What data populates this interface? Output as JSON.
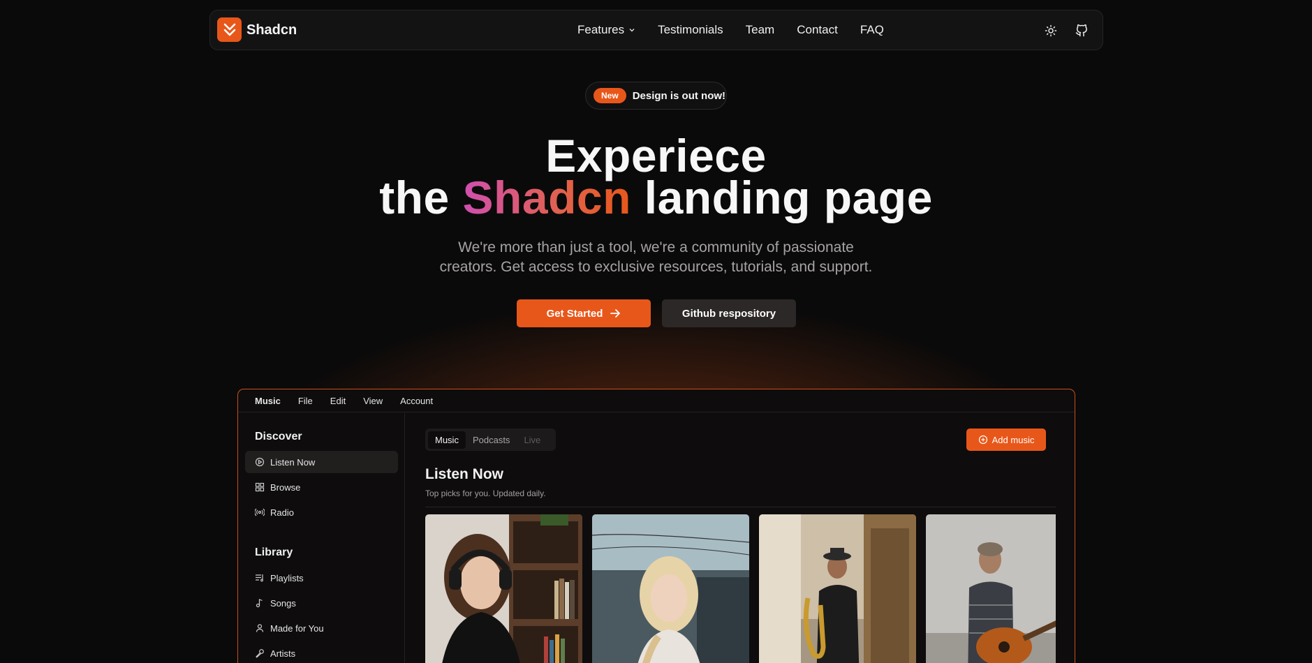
{
  "navbar": {
    "brand": "Shadcn",
    "links": [
      {
        "label": "Features",
        "has_dropdown": true
      },
      {
        "label": "Testimonials"
      },
      {
        "label": "Team"
      },
      {
        "label": "Contact"
      },
      {
        "label": "FAQ"
      }
    ],
    "icons": [
      "sun-icon",
      "github-icon"
    ]
  },
  "hero": {
    "badge_pill": "New",
    "badge_text": "Design is out now!",
    "title_line1": "Experiece",
    "title_line2_pre": "the",
    "title_line2_brand": "Shadcn",
    "title_line2_post": "landing page",
    "subtitle_line1": "We're more than just a tool, we're a community of passionate",
    "subtitle_line2": "creators. Get access to exclusive resources, tutorials, and support.",
    "primary_cta": "Get Started",
    "secondary_cta": "Github respository"
  },
  "app": {
    "menubar": [
      "Music",
      "File",
      "Edit",
      "View",
      "Account"
    ],
    "sidebar": {
      "discover_heading": "Discover",
      "discover_items": [
        {
          "label": "Listen Now",
          "icon": "play-circle-icon",
          "active": true
        },
        {
          "label": "Browse",
          "icon": "grid-icon"
        },
        {
          "label": "Radio",
          "icon": "radio-icon"
        }
      ],
      "library_heading": "Library",
      "library_items": [
        {
          "label": "Playlists",
          "icon": "playlist-icon"
        },
        {
          "label": "Songs",
          "icon": "music-note-icon"
        },
        {
          "label": "Made for You",
          "icon": "user-icon"
        },
        {
          "label": "Artists",
          "icon": "microphone-icon"
        }
      ]
    },
    "tabs": [
      {
        "label": "Music",
        "state": "active"
      },
      {
        "label": "Podcasts",
        "state": "normal"
      },
      {
        "label": "Live",
        "state": "disabled"
      }
    ],
    "add_button": "Add music",
    "section_title": "Listen Now",
    "section_subtitle": "Top picks for you. Updated daily."
  },
  "colors": {
    "accent": "#e8571a",
    "background": "#0b0a0a",
    "gradient_start": "#d04fb0",
    "gradient_end": "#e8571a"
  }
}
